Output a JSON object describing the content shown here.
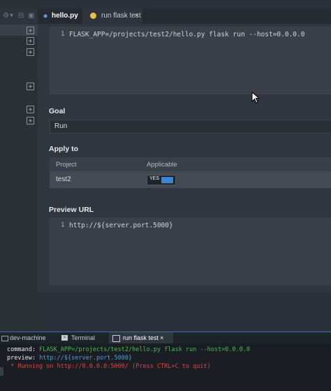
{
  "tabs": {
    "hello": {
      "label": "hello.py"
    },
    "flask": {
      "label": "run flask test",
      "close": "×"
    }
  },
  "command": {
    "line_number": "1",
    "text": "FLASK_APP=/projects/test2/hello.py flask run --host=0.0.0.0"
  },
  "goal": {
    "label": "Goal",
    "value": "Run"
  },
  "apply_to": {
    "label": "Apply to",
    "headers": [
      "Project",
      "Applicable"
    ],
    "rows": [
      {
        "project": "test2",
        "applicable": "YES"
      }
    ]
  },
  "preview": {
    "label": "Preview URL",
    "line_number": "1",
    "text": "http://${server.port.5000}"
  },
  "bottom_tabs": [
    {
      "label": "dev-machine"
    },
    {
      "label": "Terminal"
    },
    {
      "label": "run flask test",
      "close": "×"
    }
  ],
  "terminal": {
    "command_key": "command:",
    "command_value": "FLASK_APP=/projects/test2/hello.py flask run --host=0.0.0.0",
    "preview_key": "preview:",
    "preview_value": "http://${server.port.5000}",
    "running": " * Running on http://0.0.0.0:5000/ (Press CTRL+C to quit)"
  },
  "colors": {
    "accent": "#3a86d6",
    "terminal_green": "#3cc04c",
    "terminal_link": "#4d9de0",
    "terminal_error": "#e0453a"
  }
}
